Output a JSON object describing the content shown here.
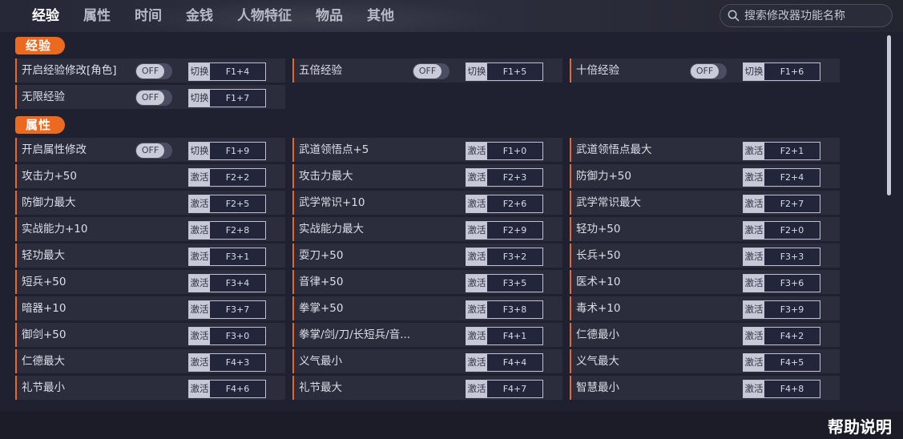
{
  "tabs": [
    "经验",
    "属性",
    "时间",
    "金钱",
    "人物特征",
    "物品",
    "其他"
  ],
  "search": {
    "placeholder": "搜索修改器功能名称"
  },
  "toggle_off": "OFF",
  "sections": [
    {
      "label": "经验",
      "items": [
        {
          "name": "开启经验修改[角色]",
          "toggle": true,
          "action": "切换",
          "key": "F1+4"
        },
        {
          "name": "五倍经验",
          "toggle": true,
          "action": "切换",
          "key": "F1+5"
        },
        {
          "name": "十倍经验",
          "toggle": true,
          "action": "切换",
          "key": "F1+6"
        },
        {
          "name": "无限经验",
          "toggle": true,
          "action": "切换",
          "key": "F1+7"
        }
      ]
    },
    {
      "label": "属性",
      "items": [
        {
          "name": "开启属性修改",
          "toggle": true,
          "action": "切换",
          "key": "F1+9"
        },
        {
          "name": "武道领悟点+5",
          "toggle": false,
          "action": "激活",
          "key": "F1+0"
        },
        {
          "name": "武道领悟点最大",
          "toggle": false,
          "action": "激活",
          "key": "F2+1"
        },
        {
          "name": "攻击力+50",
          "toggle": false,
          "action": "激活",
          "key": "F2+2"
        },
        {
          "name": "攻击力最大",
          "toggle": false,
          "action": "激活",
          "key": "F2+3"
        },
        {
          "name": "防御力+50",
          "toggle": false,
          "action": "激活",
          "key": "F2+4"
        },
        {
          "name": "防御力最大",
          "toggle": false,
          "action": "激活",
          "key": "F2+5"
        },
        {
          "name": "武学常识+10",
          "toggle": false,
          "action": "激活",
          "key": "F2+6"
        },
        {
          "name": "武学常识最大",
          "toggle": false,
          "action": "激活",
          "key": "F2+7"
        },
        {
          "name": "实战能力+10",
          "toggle": false,
          "action": "激活",
          "key": "F2+8"
        },
        {
          "name": "实战能力最大",
          "toggle": false,
          "action": "激活",
          "key": "F2+9"
        },
        {
          "name": "轻功+50",
          "toggle": false,
          "action": "激活",
          "key": "F2+0"
        },
        {
          "name": "轻功最大",
          "toggle": false,
          "action": "激活",
          "key": "F3+1"
        },
        {
          "name": "耍刀+50",
          "toggle": false,
          "action": "激活",
          "key": "F3+2"
        },
        {
          "name": "长兵+50",
          "toggle": false,
          "action": "激活",
          "key": "F3+3"
        },
        {
          "name": "短兵+50",
          "toggle": false,
          "action": "激活",
          "key": "F3+4"
        },
        {
          "name": "音律+50",
          "toggle": false,
          "action": "激活",
          "key": "F3+5"
        },
        {
          "name": "医术+10",
          "toggle": false,
          "action": "激活",
          "key": "F3+6"
        },
        {
          "name": "暗器+10",
          "toggle": false,
          "action": "激活",
          "key": "F3+7"
        },
        {
          "name": "拳掌+50",
          "toggle": false,
          "action": "激活",
          "key": "F3+8"
        },
        {
          "name": "毒术+10",
          "toggle": false,
          "action": "激活",
          "key": "F3+9"
        },
        {
          "name": "御剑+50",
          "toggle": false,
          "action": "激活",
          "key": "F3+0"
        },
        {
          "name": "拳掌/剑/刀/长短兵/音...",
          "toggle": false,
          "action": "激活",
          "key": "F4+1"
        },
        {
          "name": "仁德最小",
          "toggle": false,
          "action": "激活",
          "key": "F4+2"
        },
        {
          "name": "仁德最大",
          "toggle": false,
          "action": "激活",
          "key": "F4+3"
        },
        {
          "name": "义气最小",
          "toggle": false,
          "action": "激活",
          "key": "F4+4"
        },
        {
          "name": "义气最大",
          "toggle": false,
          "action": "激活",
          "key": "F4+5"
        },
        {
          "name": "礼节最小",
          "toggle": false,
          "action": "激活",
          "key": "F4+6"
        },
        {
          "name": "礼节最大",
          "toggle": false,
          "action": "激活",
          "key": "F4+7"
        },
        {
          "name": "智慧最小",
          "toggle": false,
          "action": "激活",
          "key": "F4+8"
        }
      ]
    }
  ],
  "footer": {
    "help": "帮助说明"
  },
  "colors": {
    "accent": "#ec6a1f",
    "background": "#1f2130",
    "row": "#2b2d3d"
  }
}
